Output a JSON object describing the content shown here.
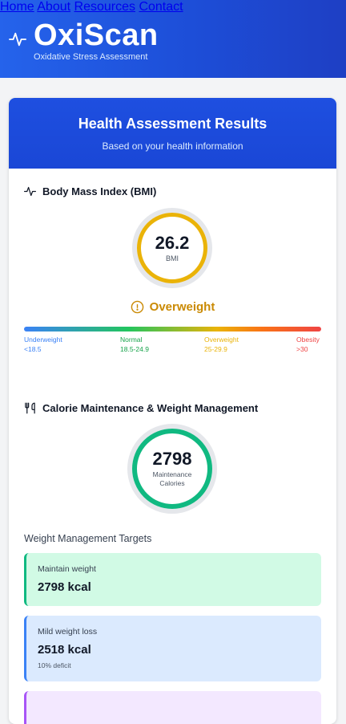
{
  "header": {
    "title": "OxiScan",
    "subtitle": "Oxidative Stress Assessment",
    "nav": [
      "Home",
      "About",
      "Resources",
      "Contact"
    ]
  },
  "results": {
    "title": "Health Assessment Results",
    "subtitle": "Based on your health information"
  },
  "bmi": {
    "section_title": "Body Mass Index (BMI)",
    "value": "26.2",
    "label": "BMI",
    "status": "Overweight",
    "scale": [
      {
        "name": "Underweight",
        "range": "<18.5",
        "color": "#3b82f6"
      },
      {
        "name": "Normal",
        "range": "18.5-24.9",
        "color": "#16a34a"
      },
      {
        "name": "Overweight",
        "range": "25-29.9",
        "color": "#eab308"
      },
      {
        "name": "Obesity",
        "range": ">30",
        "color": "#ef4444"
      }
    ]
  },
  "calories": {
    "section_title": "Calorie Maintenance & Weight Management",
    "value": "2798",
    "label_line1": "Maintenance",
    "label_line2": "Calories",
    "targets_title": "Weight Management Targets",
    "targets": [
      {
        "name": "Maintain weight",
        "kcal": "2798 kcal",
        "note": ""
      },
      {
        "name": "Mild weight loss",
        "kcal": "2518 kcal",
        "note": "10% deficit"
      }
    ]
  },
  "colors": {
    "header_blue": "#2563eb",
    "bmi_ring": "#eab308",
    "calorie_ring": "#10b981"
  }
}
